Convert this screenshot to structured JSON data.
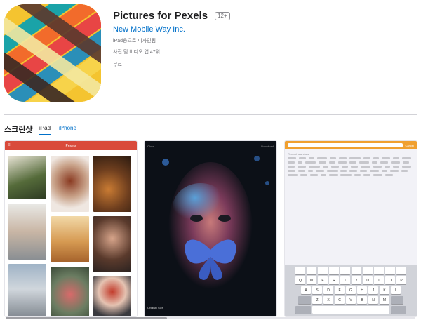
{
  "app": {
    "title": "Pictures for Pexels",
    "age_rating": "12+",
    "developer": "New Mobile Way Inc.",
    "designed_for": "iPad용으로 디자인됨",
    "ranking": "사진 및 비디오 앱 47위",
    "price": "무료",
    "icon": "woven-ribbons-app-icon"
  },
  "screenshots": {
    "heading": "스크린샷",
    "tabs": [
      {
        "label": "iPad",
        "active": true
      },
      {
        "label": "iPhone",
        "active": false
      }
    ],
    "shot1": {
      "bar_title": "Pexels",
      "menu_icon": "hamburger-icon"
    },
    "shot2": {
      "left_label": "Close",
      "right_label": "Download",
      "caption": "Original Size"
    },
    "shot3": {
      "cancel_label": "Cancel",
      "section_label": "Recent searches"
    },
    "keyboard": {
      "row1": [
        "Q",
        "W",
        "E",
        "R",
        "T",
        "Y",
        "U",
        "I",
        "O",
        "P"
      ],
      "row2": [
        "A",
        "S",
        "D",
        "F",
        "G",
        "H",
        "J",
        "K",
        "L"
      ],
      "row3": [
        "Z",
        "X",
        "C",
        "V",
        "B",
        "N",
        "M"
      ]
    }
  },
  "colors": {
    "accent_link": "#0070c9",
    "shot1_bar": "#d94a3b",
    "shot3_bar": "#f0a030"
  }
}
